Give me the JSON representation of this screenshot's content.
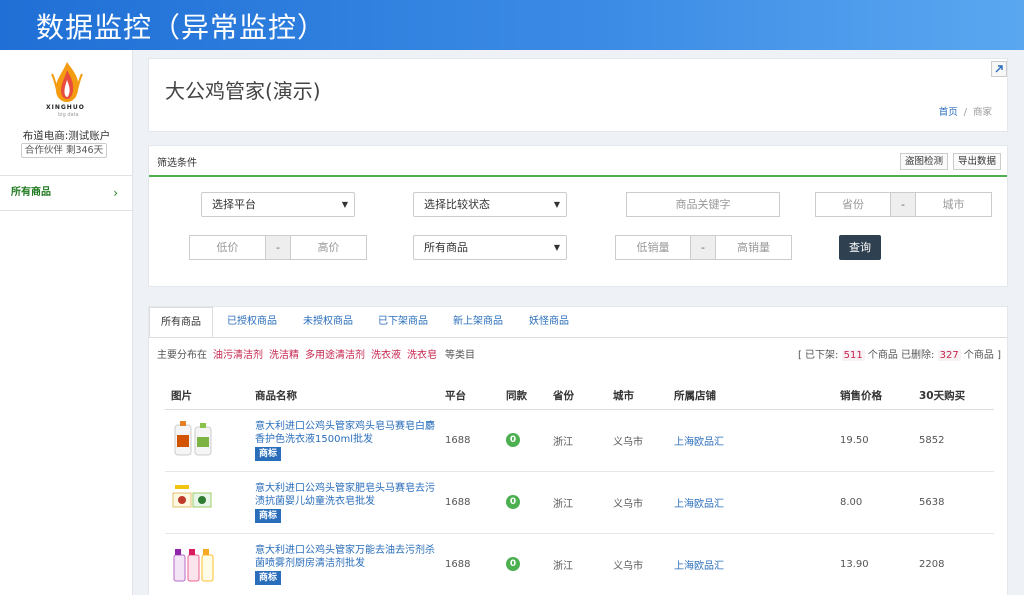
{
  "header": {
    "title": "数据监控（异常监控）"
  },
  "sidebar": {
    "logo_brand": "XINGHUO",
    "logo_sub": "big data",
    "account_name": "布道电商:测试账户",
    "partner": "合作伙伴 剩346天",
    "items": [
      {
        "label": "所有商品",
        "chevron": "›"
      }
    ]
  },
  "store": {
    "title": "大公鸡管家(演示)",
    "breadcrumb": {
      "home": "首页",
      "sep": "/",
      "current": "商家"
    }
  },
  "filter": {
    "title": "筛选条件",
    "btn_piracy": "盗图检测",
    "btn_export": "导出数据",
    "platform_select": "选择平台",
    "compare_select": "选择比较状态",
    "keyword_placeholder": "商品关键字",
    "province_placeholder": "省份",
    "city_placeholder": "城市",
    "price_low_placeholder": "低价",
    "price_high_placeholder": "高价",
    "goods_select": "所有商品",
    "sales_low_placeholder": "低销量",
    "sales_high_placeholder": "高销量",
    "dash": "-",
    "query_button": "查询"
  },
  "tabs": [
    "所有商品",
    "已授权商品",
    "未授权商品",
    "已下架商品",
    "新上架商品",
    "妖怪商品"
  ],
  "distribution": {
    "label": "主要分布在",
    "tags": [
      "油污清洁剂",
      "洗洁精",
      "多用途清洁剂",
      "洗衣液",
      "洗衣皂"
    ],
    "tail": "等类目"
  },
  "summary": {
    "prefix": "[ 已下架:",
    "offline": "511",
    "mid": "个商品 已删除:",
    "deleted": "327",
    "suffix": "个商品 ]"
  },
  "table": {
    "columns": [
      "图片",
      "商品名称",
      "平台",
      "同款",
      "省份",
      "城市",
      "所属店铺",
      "销售价格",
      "30天购买"
    ],
    "trademark_label": "商标",
    "rows": [
      {
        "name": "意大利进口公鸡头管家鸡头皂马赛皂白麝香护色洗衣液1500ml批发",
        "platform": "1688",
        "same": "0",
        "province": "浙江",
        "city": "义乌市",
        "shop": "上海欧品汇",
        "price": "19.50",
        "sold30": "5852"
      },
      {
        "name": "意大利进口公鸡头管家肥皂头马赛皂去污渍抗菌婴儿幼童洗衣皂批发",
        "platform": "1688",
        "same": "0",
        "province": "浙江",
        "city": "义乌市",
        "shop": "上海欧品汇",
        "price": "8.00",
        "sold30": "5638"
      },
      {
        "name": "意大利进口公鸡头管家万能去油去污剂杀菌喷雾剂厨房清洁剂批发",
        "platform": "1688",
        "same": "0",
        "province": "浙江",
        "city": "义乌市",
        "shop": "上海欧品汇",
        "price": "13.90",
        "sold30": "2208"
      }
    ]
  },
  "colors": {
    "accent": "#1f6fd6",
    "link": "#2a6ebb",
    "success": "#4caf50",
    "highlight": "#c7254e"
  }
}
